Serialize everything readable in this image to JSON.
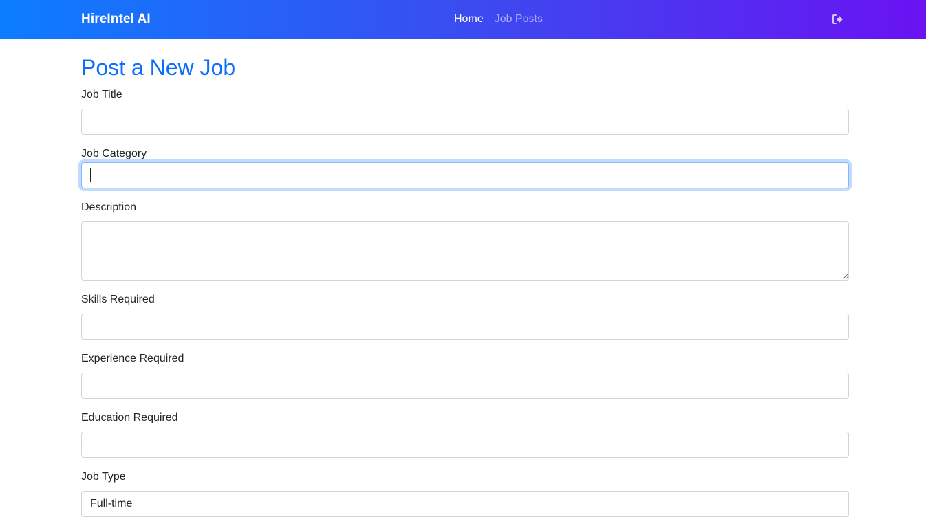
{
  "navbar": {
    "brand": "HireIntel AI",
    "links": [
      {
        "label": "Home",
        "active": true
      },
      {
        "label": "Job Posts",
        "active": false
      }
    ],
    "logout_icon": "sign-out-icon",
    "gradient_start": "#0d7dff",
    "gradient_end": "#6a12f2"
  },
  "page": {
    "title": "Post a New Job",
    "title_color": "#0d6efd"
  },
  "form": {
    "job_title": {
      "label": "Job Title",
      "value": ""
    },
    "job_category": {
      "label": "Job Category",
      "value": "",
      "focused": true
    },
    "description": {
      "label": "Description",
      "value": ""
    },
    "skills": {
      "label": "Skills Required",
      "value": ""
    },
    "experience": {
      "label": "Experience Required",
      "value": ""
    },
    "education": {
      "label": "Education Required",
      "value": ""
    },
    "job_type": {
      "label": "Job Type",
      "value": "Full-time"
    }
  }
}
